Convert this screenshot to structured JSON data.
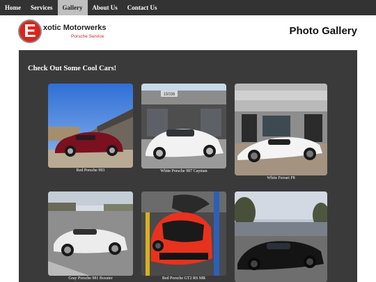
{
  "nav": {
    "items": [
      {
        "label": "Home",
        "active": false
      },
      {
        "label": "Services",
        "active": false
      },
      {
        "label": "Gallery",
        "active": true
      },
      {
        "label": "About Us",
        "active": false
      },
      {
        "label": "Contact Us",
        "active": false
      }
    ]
  },
  "header": {
    "logo_letter": "E",
    "logo_name": "xotic Motorwerks",
    "logo_subtitle": "Porsche Service",
    "page_title": "Photo Gallery"
  },
  "gallery": {
    "heading": "Check Out Some Cool Cars!",
    "photos": [
      {
        "caption": "Red Porsche 993",
        "car_color": "#7a1020",
        "sign_text": ""
      },
      {
        "caption": "White Porsche 987 Cayman",
        "car_color": "#f2f2f2",
        "sign_text": "15036"
      },
      {
        "caption": "White Ferrari F8",
        "car_color": "#f4f4f4",
        "sign_text": ""
      },
      {
        "caption": "Gray Porsche 981 Boxster",
        "car_color": "#ececec",
        "sign_text": ""
      },
      {
        "caption": "Red Porsche GT2 RS MR",
        "car_color": "#e8321e",
        "sign_text": ""
      },
      {
        "caption": "",
        "car_color": "#141414",
        "sign_text": ""
      }
    ]
  },
  "colors": {
    "nav_bg": "#333333",
    "nav_active_bg": "#bfbfbf",
    "panel_bg": "#3a3a3a",
    "brand_red": "#d8261d"
  }
}
